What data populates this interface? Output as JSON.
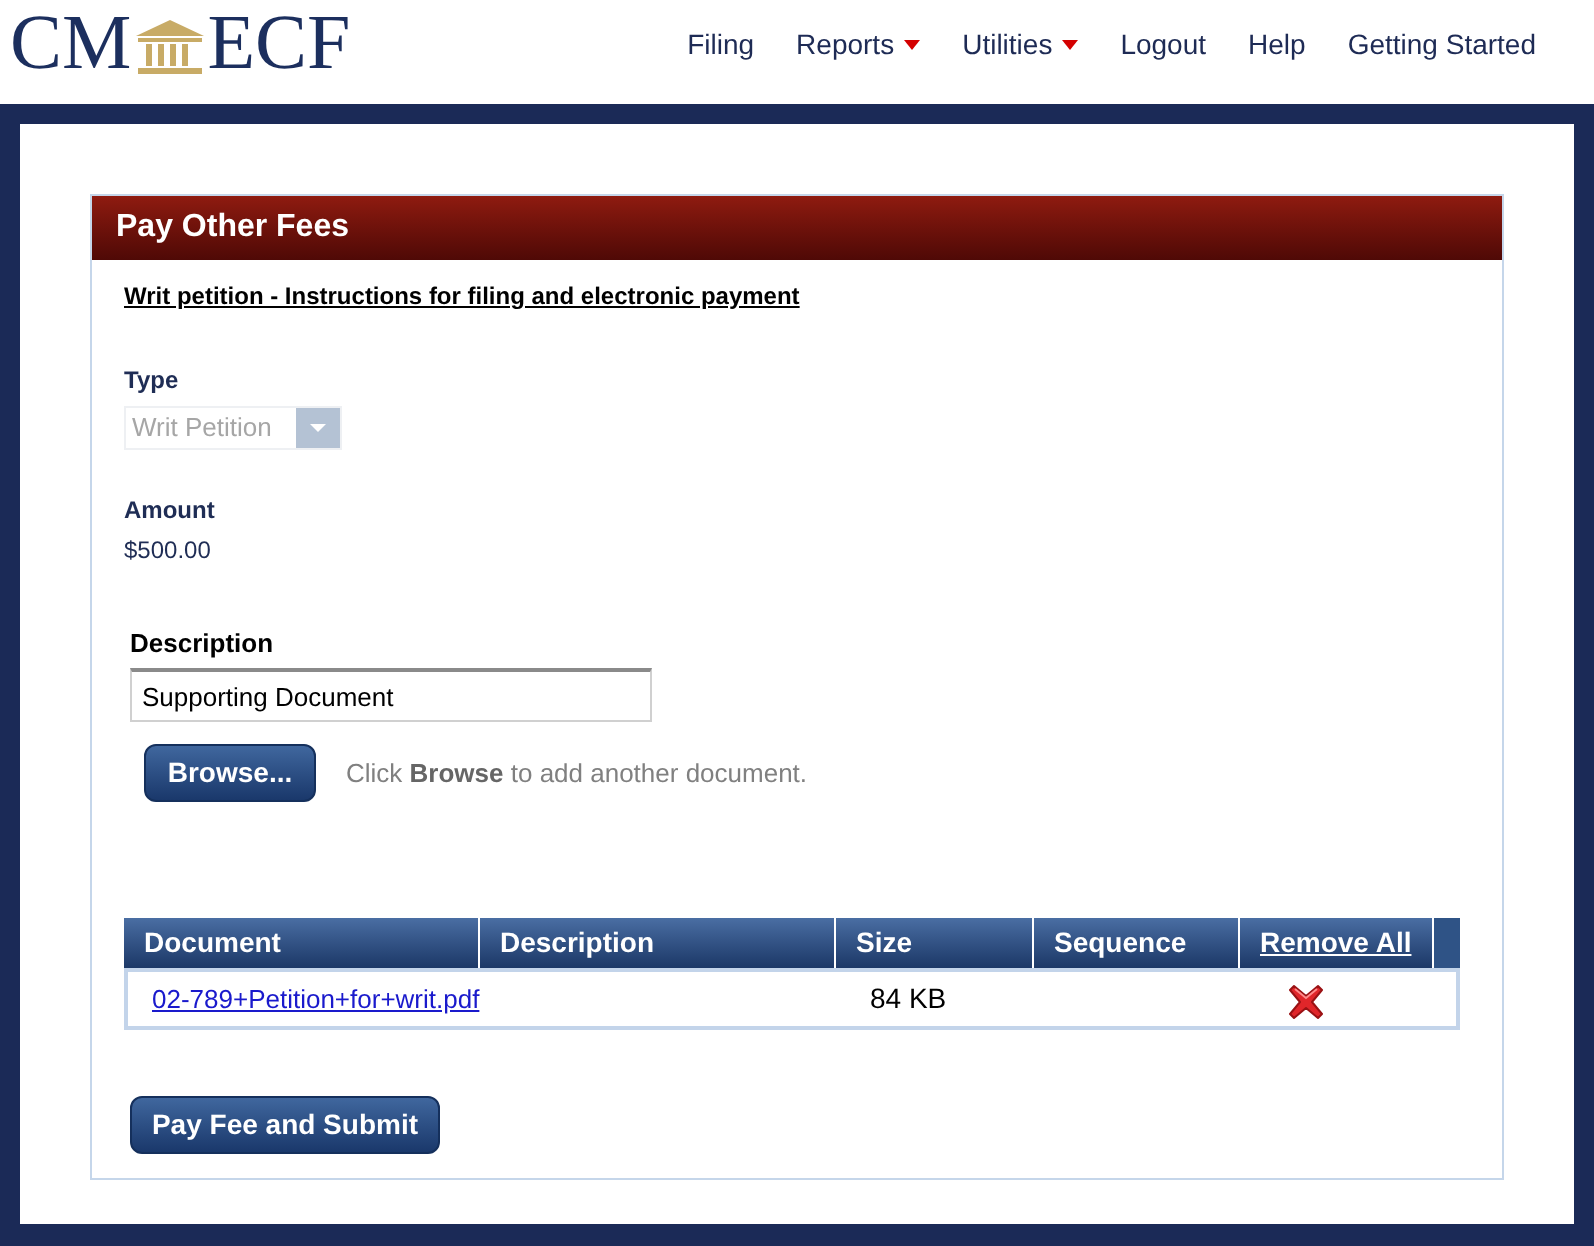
{
  "header": {
    "logo": {
      "left_text": "CM",
      "right_text": "ECF"
    },
    "nav": [
      {
        "label": "Filing",
        "has_menu": false
      },
      {
        "label": "Reports",
        "has_menu": true
      },
      {
        "label": "Utilities",
        "has_menu": true
      },
      {
        "label": "Logout",
        "has_menu": false
      },
      {
        "label": "Help",
        "has_menu": false
      },
      {
        "label": "Getting Started",
        "has_menu": false
      }
    ]
  },
  "panel": {
    "title": "Pay Other Fees",
    "instructions_link": "Writ petition - Instructions for filing and electronic payment",
    "type_field": {
      "label": "Type",
      "value": "Writ Petition",
      "disabled": true
    },
    "amount": {
      "label": "Amount",
      "value": "$500.00"
    },
    "description_field": {
      "label": "Description",
      "value": "Supporting Document"
    },
    "browse_button": "Browse...",
    "browse_hint": "Click **Browse** to add another document.",
    "documents_table": {
      "columns": [
        {
          "label": "Document",
          "kind": "text"
        },
        {
          "label": "Description",
          "kind": "text"
        },
        {
          "label": "Size",
          "kind": "text"
        },
        {
          "label": "Sequence",
          "kind": "text"
        },
        {
          "label": "Remove All",
          "kind": "link"
        }
      ],
      "rows": [
        {
          "document": "02-789+Petition+for+writ.pdf",
          "size": "84 KB",
          "removable": true
        }
      ]
    },
    "submit_button": "Pay Fee and Submit"
  }
}
